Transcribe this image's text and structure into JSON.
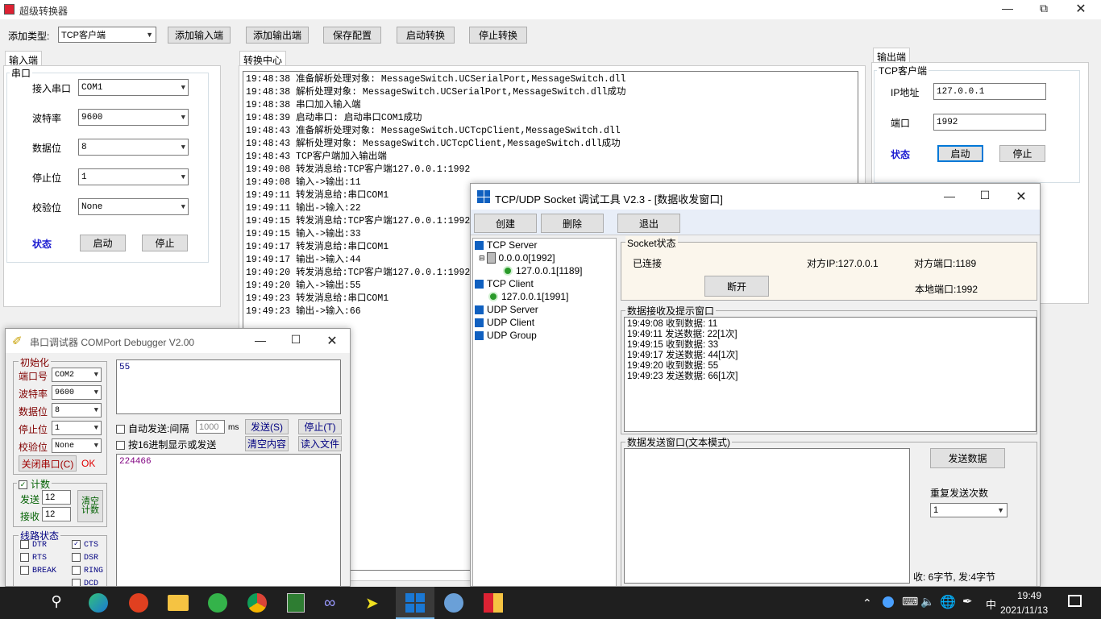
{
  "main": {
    "title": "超级转换器",
    "toolbar": {
      "add_type_label": "添加类型:",
      "add_type_value": "TCP客户端",
      "add_input": "添加输入端",
      "add_output": "添加输出端",
      "save_config": "保存配置",
      "start": "启动转换",
      "stop": "停止转换"
    },
    "input_tab": "输入端",
    "input_group": "串口",
    "input_fields": [
      {
        "label": "接入串口",
        "value": "COM1"
      },
      {
        "label": "波特率",
        "value": "9600"
      },
      {
        "label": "数据位",
        "value": "8"
      },
      {
        "label": "停止位",
        "value": "1"
      },
      {
        "label": "校验位",
        "value": "None"
      }
    ],
    "status_label": "状态",
    "start_btn": "启动",
    "stop_btn": "停止",
    "center_tab": "转换中心",
    "log": [
      "19:48:38 准备解析处理对象: MessageSwitch.UCSerialPort,MessageSwitch.dll",
      "19:48:38 解析处理对象: MessageSwitch.UCSerialPort,MessageSwitch.dll成功",
      "19:48:38 串口加入输入端",
      "19:48:39 启动串口: 启动串口COM1成功",
      "19:48:43 准备解析处理对象: MessageSwitch.UCTcpClient,MessageSwitch.dll",
      "19:48:43 解析处理对象: MessageSwitch.UCTcpClient,MessageSwitch.dll成功",
      "19:48:43 TCP客户端加入输出端",
      "19:49:08 转发消息给:TCP客户端127.0.0.1:1992",
      "19:49:08 输入->输出:11",
      "19:49:11 转发消息给:串口COM1",
      "19:49:11 输出->输入:22",
      "19:49:15 转发消息给:TCP客户端127.0.0.1:1992",
      "19:49:15 输入->输出:33",
      "19:49:17 转发消息给:串口COM1",
      "19:49:17 输出->输入:44",
      "19:49:20 转发消息给:TCP客户端127.0.0.1:1992",
      "19:49:20 输入->输出:55",
      "19:49:23 转发消息给:串口COM1",
      "19:49:23 输出->输入:66"
    ],
    "output_tab": "输出端",
    "output_group": "TCP客户端",
    "ip_label": "IP地址",
    "ip_value": "127.0.0.1",
    "port_label": "端口",
    "port_value": "1992",
    "out_status": "状态",
    "out_start": "启动",
    "out_stop": "停止"
  },
  "com": {
    "title": "串口调试器 COMPort Debugger V2.00",
    "init_group": "初始化",
    "fields": [
      {
        "label": "端口号",
        "value": "COM2"
      },
      {
        "label": "波特率",
        "value": "9600"
      },
      {
        "label": "数据位",
        "value": "8"
      },
      {
        "label": "停止位",
        "value": "1"
      },
      {
        "label": "校验位",
        "value": "None"
      }
    ],
    "close_port": "关闭串口(C)",
    "ok": "OK",
    "count_group": "计数",
    "send_label": "发送",
    "send_count": "12",
    "recv_label": "接收",
    "recv_count": "12",
    "clear_count": "清空计数",
    "line_group": "线路状态",
    "lines": [
      [
        "DTR",
        "CTS"
      ],
      [
        "RTS",
        "DSR"
      ],
      [
        "BREAK",
        "RING"
      ],
      [
        "",
        "DCD"
      ]
    ],
    "send_text": "55",
    "auto_send": "自动发送:间隔",
    "interval": "1000",
    "ms": "ms",
    "send_btn": "发送(S)",
    "stop_btn": "停止(T)",
    "hex_label": "按16进制显示或发送",
    "clear_btn": "清空内容",
    "read_file": "读入文件",
    "recv_text": "224466"
  },
  "tcp": {
    "title": "TCP/UDP Socket 调试工具 V2.3 - [数据收发窗口]",
    "create": "创建",
    "delete": "删除",
    "exit": "退出",
    "tree": {
      "server": "TCP Server",
      "server_node": "0.0.0.0[1992]",
      "server_child": "127.0.0.1[1189]",
      "client": "TCP Client",
      "client_node": "127.0.0.1[1991]",
      "udp_server": "UDP Server",
      "udp_client": "UDP Client",
      "udp_group": "UDP Group"
    },
    "socket_group": "Socket状态",
    "connected": "已连接",
    "peer_ip": "对方IP:127.0.0.1",
    "peer_port": "对方端口:1189",
    "local_port": "本地端口:1992",
    "disconnect": "断开",
    "recv_group": "数据接收及提示窗口",
    "recv_lines": [
      "19:49:08 收到数据: 11",
      "19:49:11 发送数据: 22[1次]",
      "19:49:15 收到数据: 33",
      "19:49:17 发送数据: 44[1次]",
      "19:49:20 收到数据: 55",
      "19:49:23 发送数据: 66[1次]"
    ],
    "send_group": "数据发送窗口(文本模式)",
    "send_data": "发送数据",
    "repeat_label": "重复发送次数",
    "repeat_value": "1",
    "stat": "收: 6字节, 发:4字节"
  },
  "taskbar": {
    "time": "19:49",
    "date": "2021/11/13",
    "ime": "中"
  }
}
